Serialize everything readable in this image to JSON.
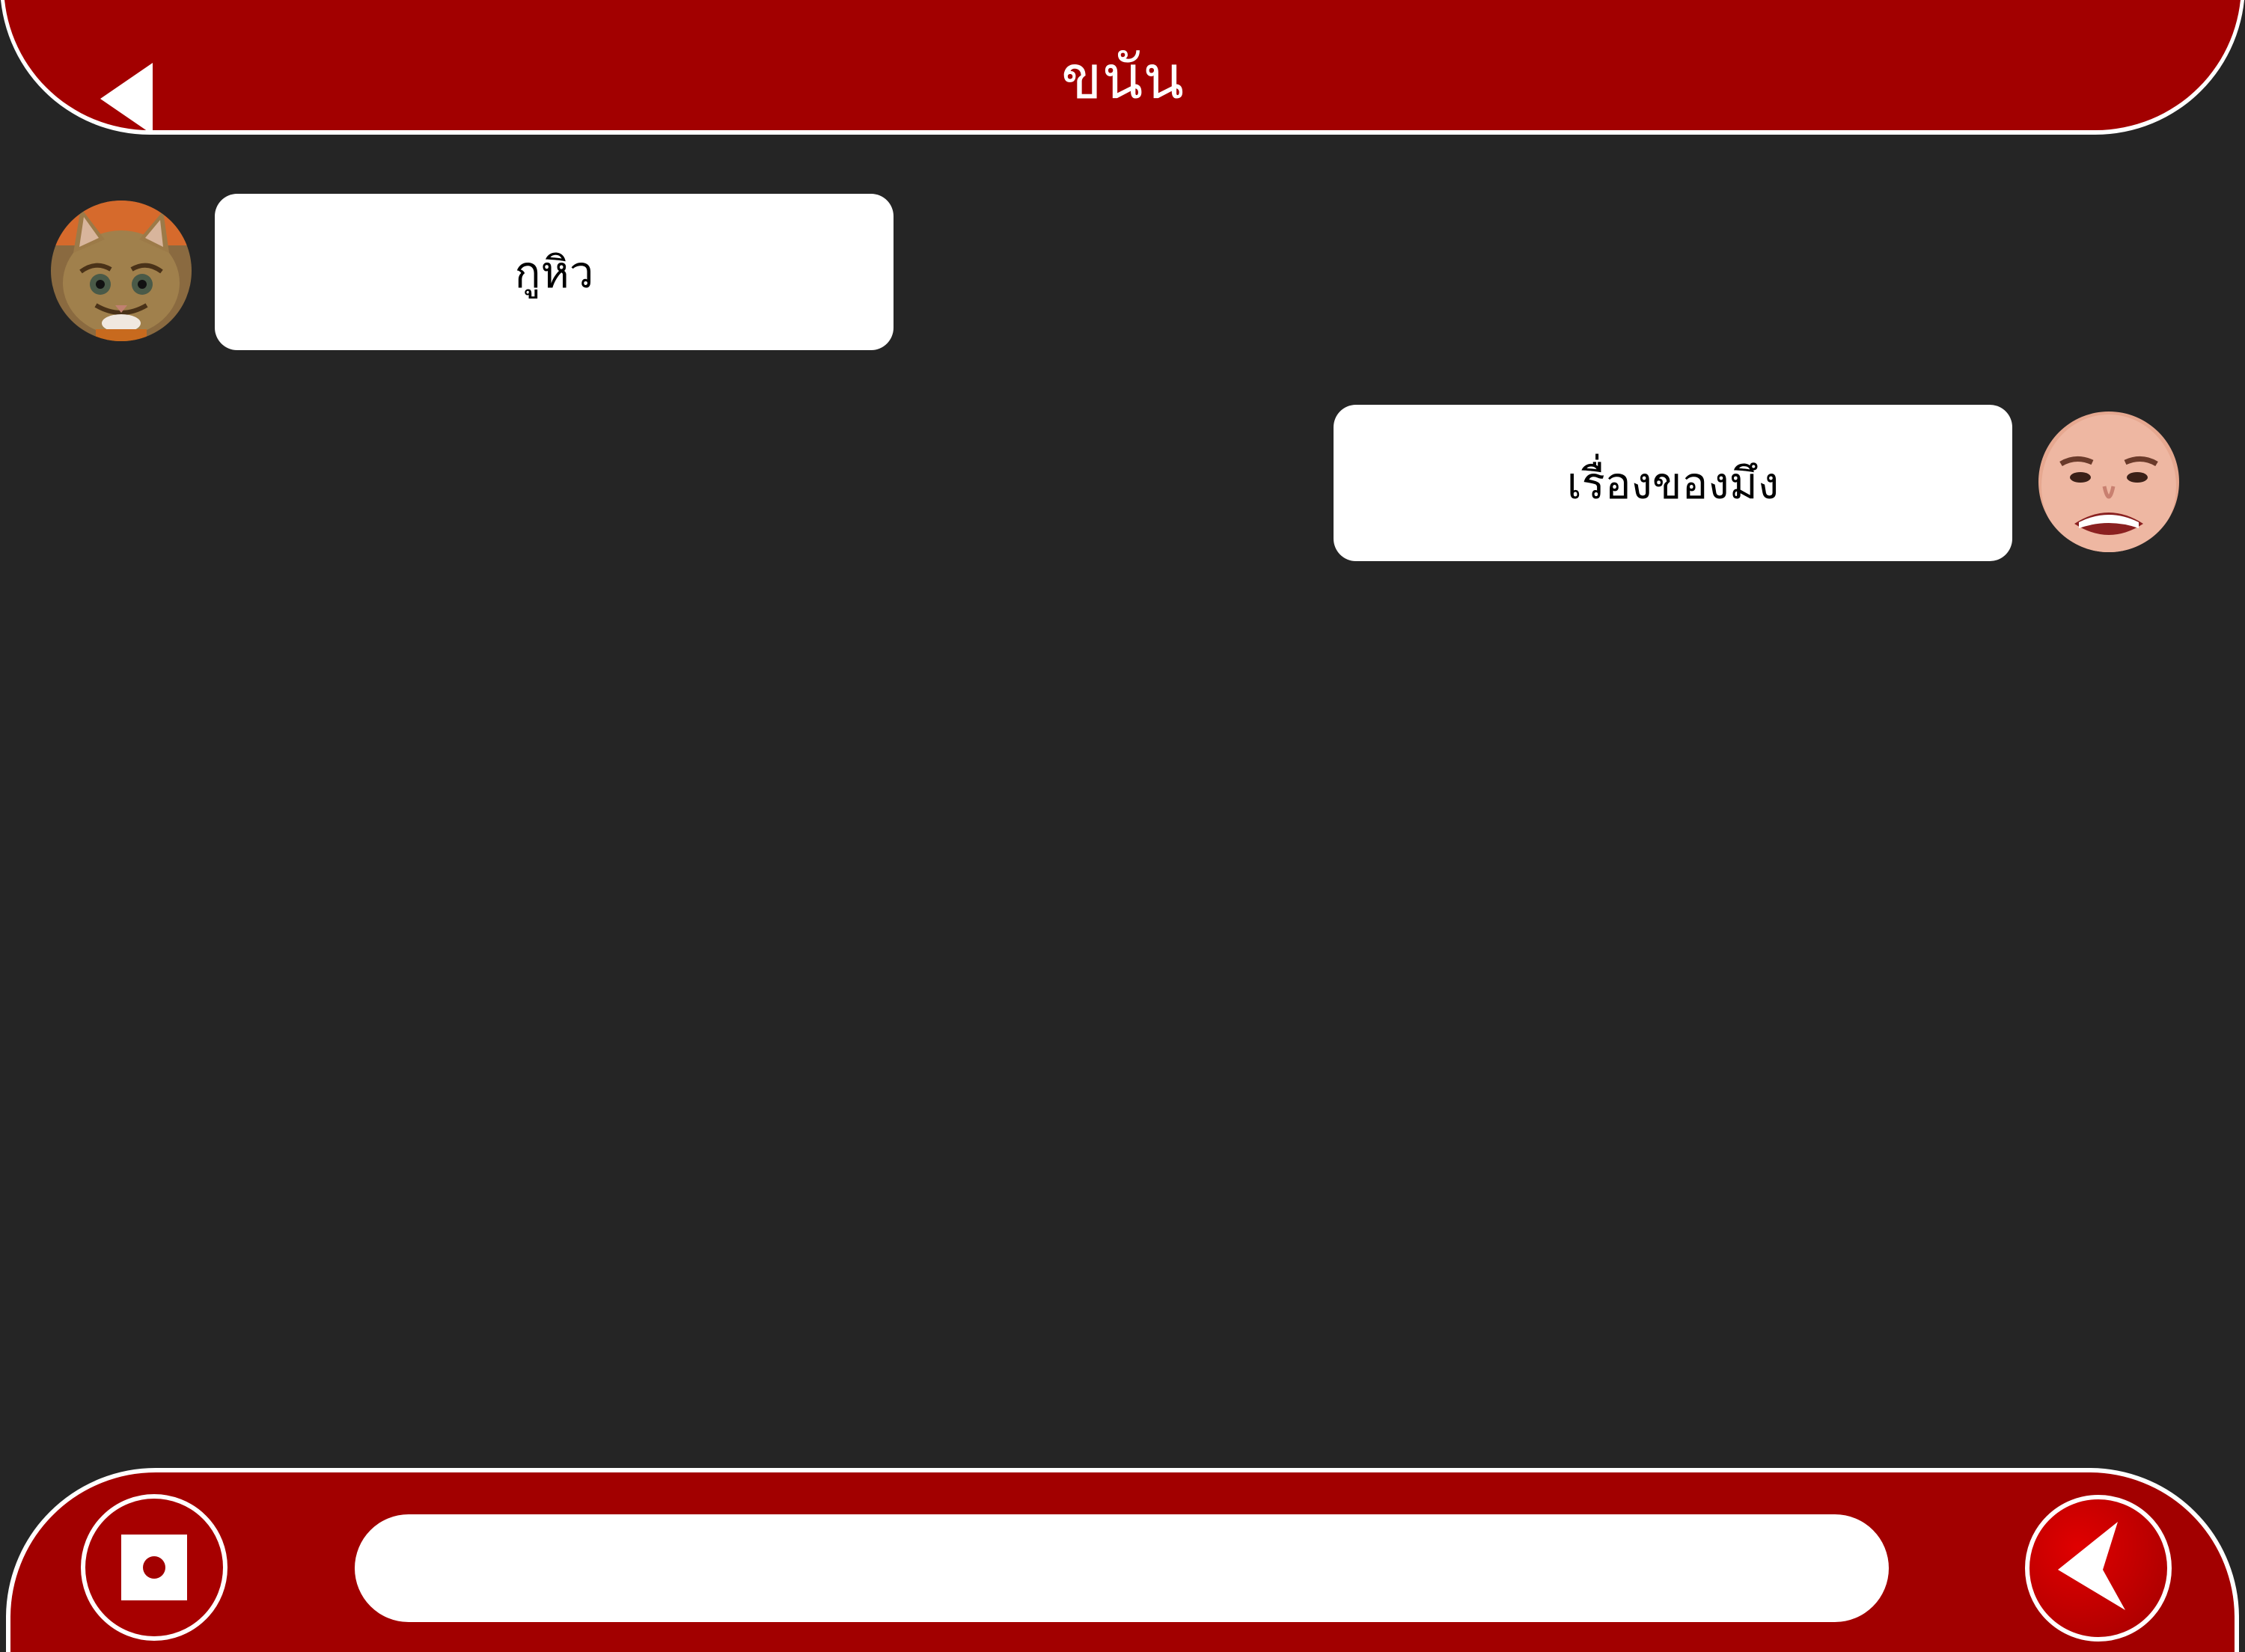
{
  "header": {
    "title": "ขนัน",
    "back_icon": "back-triangle-icon"
  },
  "messages": [
    {
      "side": "left",
      "text": "กูหิว",
      "avatar": "cat-avatar"
    },
    {
      "side": "right",
      "text": "เรื่องของมึง",
      "avatar": "user-face-avatar"
    }
  ],
  "composer": {
    "input_value": "",
    "input_placeholder": "",
    "stop_icon": "stop-record-icon",
    "send_icon": "send-arrow-icon"
  },
  "colors": {
    "bar": "#a20000",
    "background": "#252525",
    "bubble": "#ffffff",
    "text_light": "#ffffff",
    "text_dark": "#000000"
  }
}
